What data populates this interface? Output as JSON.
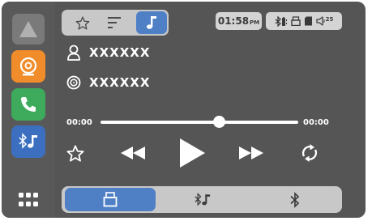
{
  "sidebar": {
    "items": [
      {
        "name": "home",
        "icon": "home-icon"
      },
      {
        "name": "radio",
        "icon": "radio-icon",
        "color": "#f08c2a"
      },
      {
        "name": "phone",
        "icon": "phone-icon",
        "color": "#3daa5c"
      },
      {
        "name": "bt-music",
        "icon": "bluetooth-music-icon",
        "color": "#3d6fc0"
      }
    ],
    "apps_icon": "grid-icon"
  },
  "top_tabs": {
    "items": [
      "favorite",
      "list",
      "music"
    ],
    "active": "music"
  },
  "status": {
    "time": "01:58",
    "ampm": "PM",
    "volume": "25"
  },
  "track": {
    "artist": "XXXXXX",
    "album": "XXXXXX"
  },
  "progress": {
    "elapsed": "00:00",
    "total": "00:00",
    "position": 0.6
  },
  "sources": {
    "items": [
      "usb",
      "bluetooth-music",
      "bluetooth"
    ],
    "active": "usb"
  },
  "colors": {
    "accent": "#4f80c6",
    "background": "#555555",
    "radio": "#f08c2a",
    "phone": "#3daa5c",
    "bluetooth": "#3d6fc0"
  }
}
